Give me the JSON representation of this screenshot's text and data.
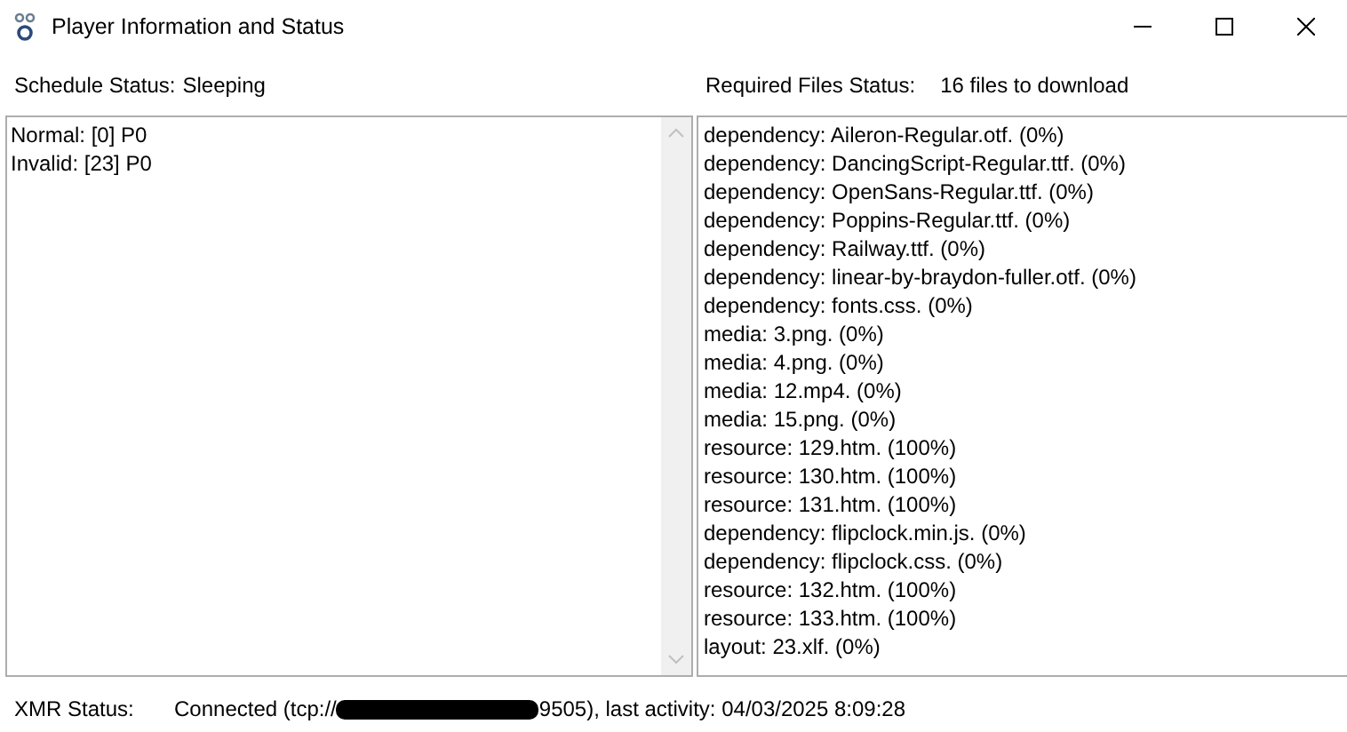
{
  "window": {
    "title": "Player Information and Status"
  },
  "schedule_status": {
    "label": "Schedule Status:",
    "value": "Sleeping"
  },
  "schedule_list": [
    "Normal: [0]  P0",
    "Invalid: [23]  P0"
  ],
  "required_files_status": {
    "label": "Required Files Status:",
    "value": "16 files to download"
  },
  "required_files_list": [
    "dependency: Aileron-Regular.otf. (0%)",
    "dependency: DancingScript-Regular.ttf. (0%)",
    "dependency: OpenSans-Regular.ttf. (0%)",
    "dependency: Poppins-Regular.ttf. (0%)",
    "dependency: Railway.ttf. (0%)",
    "dependency: linear-by-braydon-fuller.otf. (0%)",
    "dependency: fonts.css. (0%)",
    "media: 3.png. (0%)",
    "media: 4.png. (0%)",
    "media: 12.mp4. (0%)",
    "media: 15.png. (0%)",
    "resource: 129.htm. (100%)",
    "resource: 130.htm. (100%)",
    "resource: 131.htm. (100%)",
    "dependency: flipclock.min.js. (0%)",
    "dependency: flipclock.css. (0%)",
    "resource: 132.htm. (100%)",
    "resource: 133.htm. (100%)",
    "layout: 23.xlf. (0%)"
  ],
  "xmr_status": {
    "label": "XMR Status:",
    "value_before_redaction": "Connected (tcp://",
    "value_after_redaction": "9505), last activity: 04/03/2025 8:09:28"
  }
}
